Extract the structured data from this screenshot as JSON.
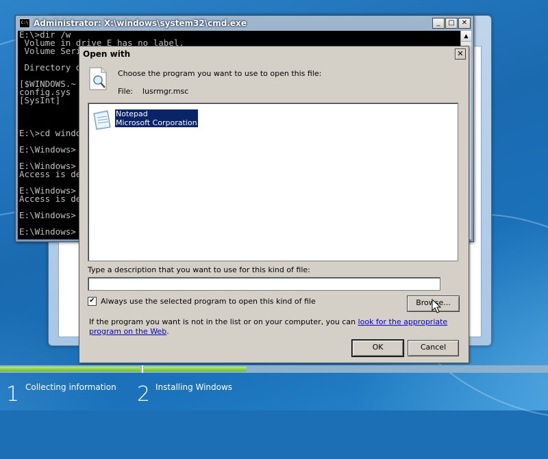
{
  "cmd": {
    "title": "Administrator: X:\\windows\\system32\\cmd.exe",
    "minimize": "_",
    "maximize": "□",
    "close": "✕",
    "lines": [
      "E:\\>dir /w",
      " Volume in drive E has no label.",
      " Volume Serial Number is ",
      "",
      " Directory of E:\\",
      "",
      "[$WINDOWS.~",
      "config.sys",
      "[SysInt]",
      "",
      "",
      "",
      "E:\\>cd windows",
      "",
      "E:\\Windows>",
      "",
      "E:\\Windows>",
      "Access is denied.",
      "",
      "E:\\Windows>",
      "Access is denied.",
      "",
      "E:\\Windows>",
      "",
      "E:\\Windows>"
    ]
  },
  "dialog": {
    "title": "Open with",
    "close": "✕",
    "prompt": "Choose the program you want to use to open this file:",
    "file_label": "File:",
    "file_name": "lusrmgr.msc",
    "programs": [
      {
        "name": "Notepad",
        "publisher": "Microsoft Corporation",
        "selected": true
      }
    ],
    "description_label": "Type a description that you want to use for this kind of file:",
    "description_value": "",
    "always_use_label": "Always use the selected program to open this kind of file",
    "always_use_checked": true,
    "checkmark": "✔",
    "browse_label": "Browse...",
    "help_text_prefix": "If the program you want is not in the list or on your computer, you can ",
    "help_link": "look for the appropriate program on the Web",
    "help_text_suffix": ".",
    "ok_label": "OK",
    "cancel_label": "Cancel"
  },
  "setup": {
    "steps": [
      {
        "number": "1",
        "label": "Collecting information"
      },
      {
        "number": "2",
        "label": "Installing Windows"
      }
    ]
  },
  "colors": {
    "selection": "#0a246a",
    "progress_green": "#6cbd2a",
    "link": "#0000cc"
  }
}
